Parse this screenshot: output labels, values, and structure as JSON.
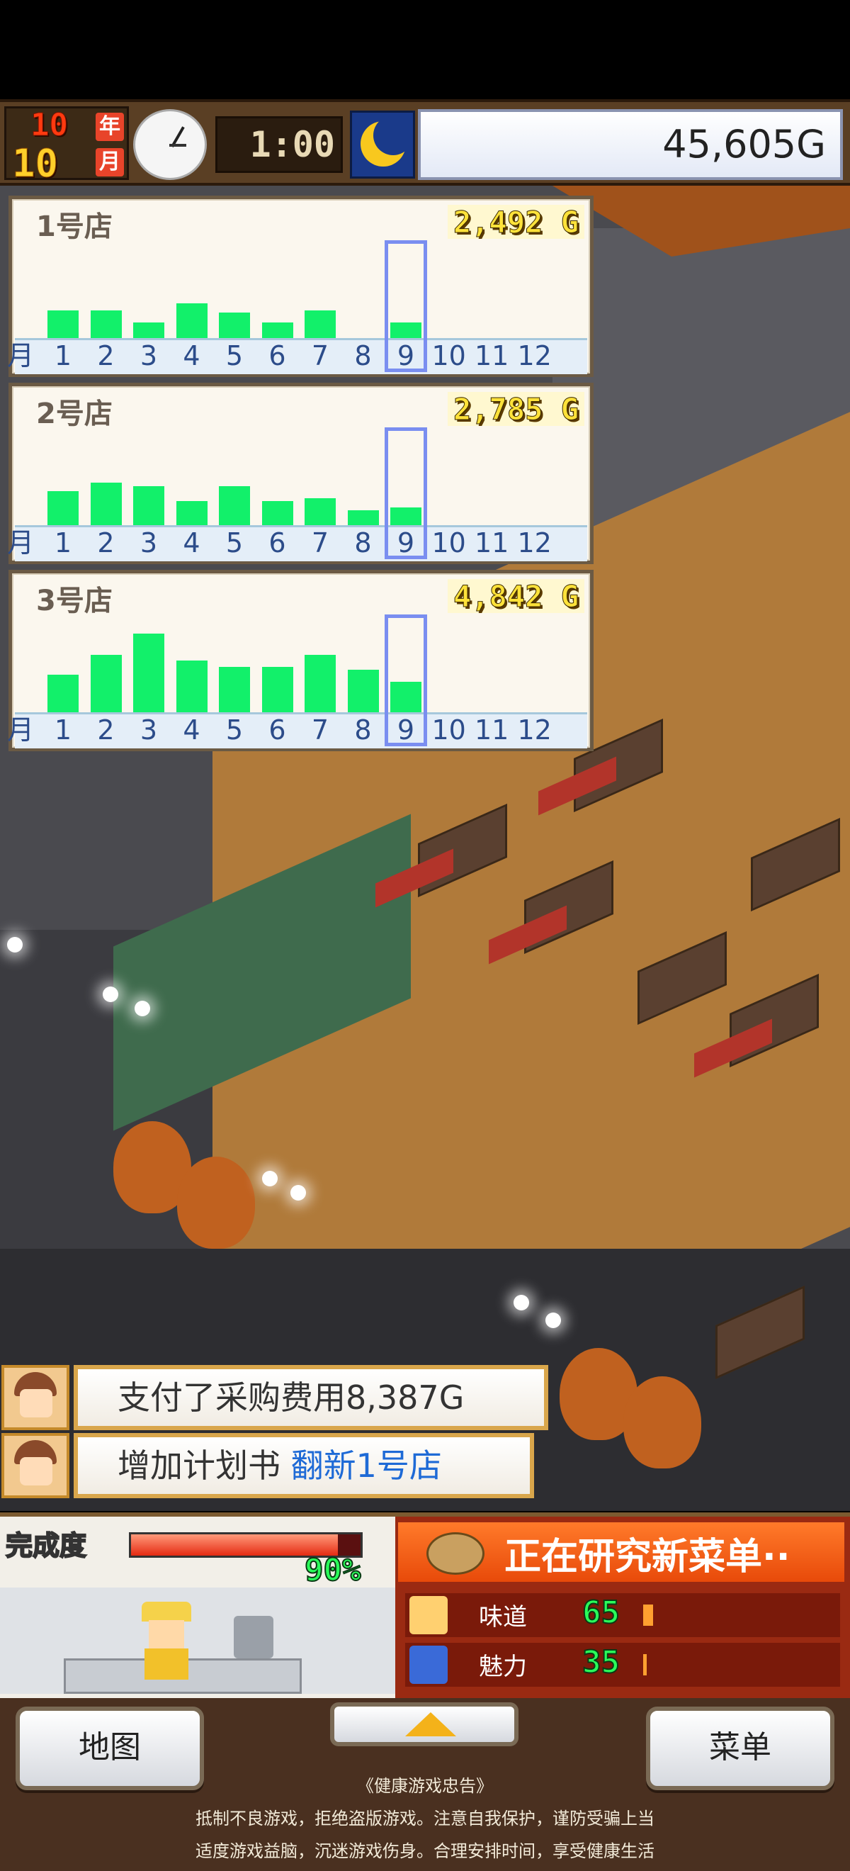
{
  "header": {
    "year_num": "10",
    "year_unit": "年",
    "month_num": "10",
    "month_unit": "月",
    "time": "1:00",
    "money": "45,605G",
    "time_of_day_icon": "moon-icon"
  },
  "months": [
    "1",
    "2",
    "3",
    "4",
    "5",
    "6",
    "7",
    "8",
    "9",
    "10",
    "11",
    "12"
  ],
  "month_axis_label": "月",
  "stores": [
    {
      "name": "1号店",
      "total": "2,492 G",
      "values": [
        0.28,
        0.28,
        0.16,
        0.35,
        0.26,
        0.16,
        0.28,
        0,
        0.16,
        0,
        0,
        0
      ],
      "selected_month": 9
    },
    {
      "name": "2号店",
      "total": "2,785 G",
      "values": [
        0.34,
        0.43,
        0.39,
        0.24,
        0.39,
        0.24,
        0.27,
        0.15,
        0.18,
        0,
        0,
        0
      ],
      "selected_month": 9
    },
    {
      "name": "3号店",
      "total": "4,842 G",
      "values": [
        0.38,
        0.58,
        0.79,
        0.52,
        0.46,
        0.46,
        0.58,
        0.43,
        0.31,
        0,
        0,
        0
      ],
      "selected_month": 9
    }
  ],
  "notifications": [
    {
      "text": "支付了采购费用8,387G",
      "highlight": ""
    },
    {
      "text": "增加计划书 ",
      "highlight": "翻新1号店"
    }
  ],
  "progress": {
    "label": "完成度",
    "percent_text": "90%",
    "percent": 0.9
  },
  "research": {
    "title": "正在研究新菜单··",
    "stats": [
      {
        "label": "味道",
        "value": "65",
        "icon": "taste-icon"
      },
      {
        "label": "魅力",
        "value": "35",
        "icon": "charm-icon"
      }
    ]
  },
  "buttons": {
    "map": "地图",
    "menu": "菜单",
    "up": "up-arrow-icon"
  },
  "health_notice": {
    "title": "《健康游戏忠告》",
    "line1": "抵制不良游戏，拒绝盗版游戏。注意自我保护，谨防受骗上当",
    "line2": "适度游戏益脑，沉迷游戏伤身。合理安排时间，享受健康生活"
  },
  "colors": {
    "bar": "#12f06a",
    "selection": "#7a8ef0",
    "highlight": "#1e6ad6"
  }
}
